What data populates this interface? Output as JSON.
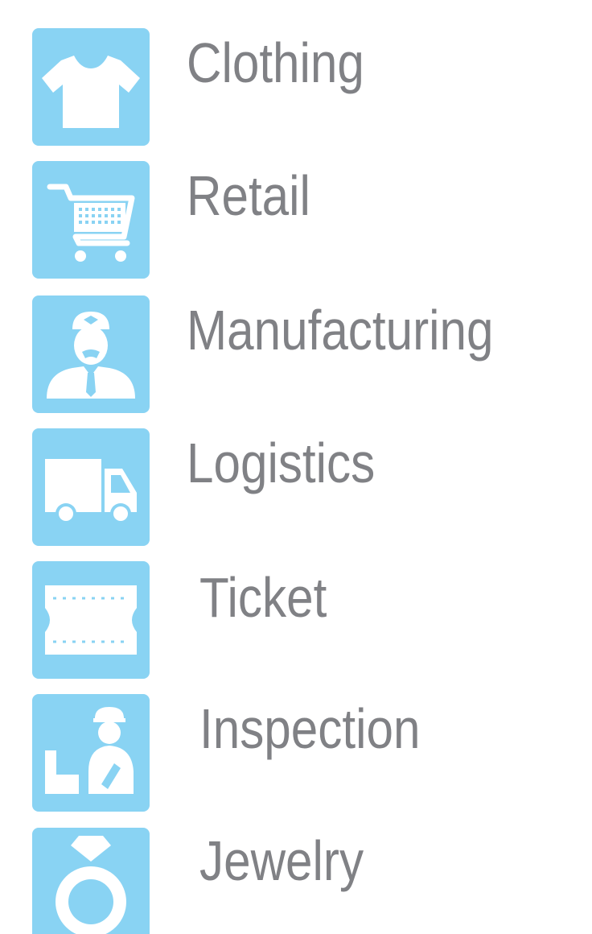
{
  "colors": {
    "tile": "#89d3f3",
    "icon": "#ffffff",
    "text": "#808185"
  },
  "items": [
    {
      "label": "Clothing",
      "icon": "tshirt-icon"
    },
    {
      "label": "Retail",
      "icon": "shopping-cart-icon"
    },
    {
      "label": "Manufacturing",
      "icon": "worker-icon"
    },
    {
      "label": "Logistics",
      "icon": "truck-icon"
    },
    {
      "label": "Ticket",
      "icon": "ticket-icon"
    },
    {
      "label": "Inspection",
      "icon": "inspector-icon"
    },
    {
      "label": "Jewelry",
      "icon": "ring-icon"
    }
  ]
}
